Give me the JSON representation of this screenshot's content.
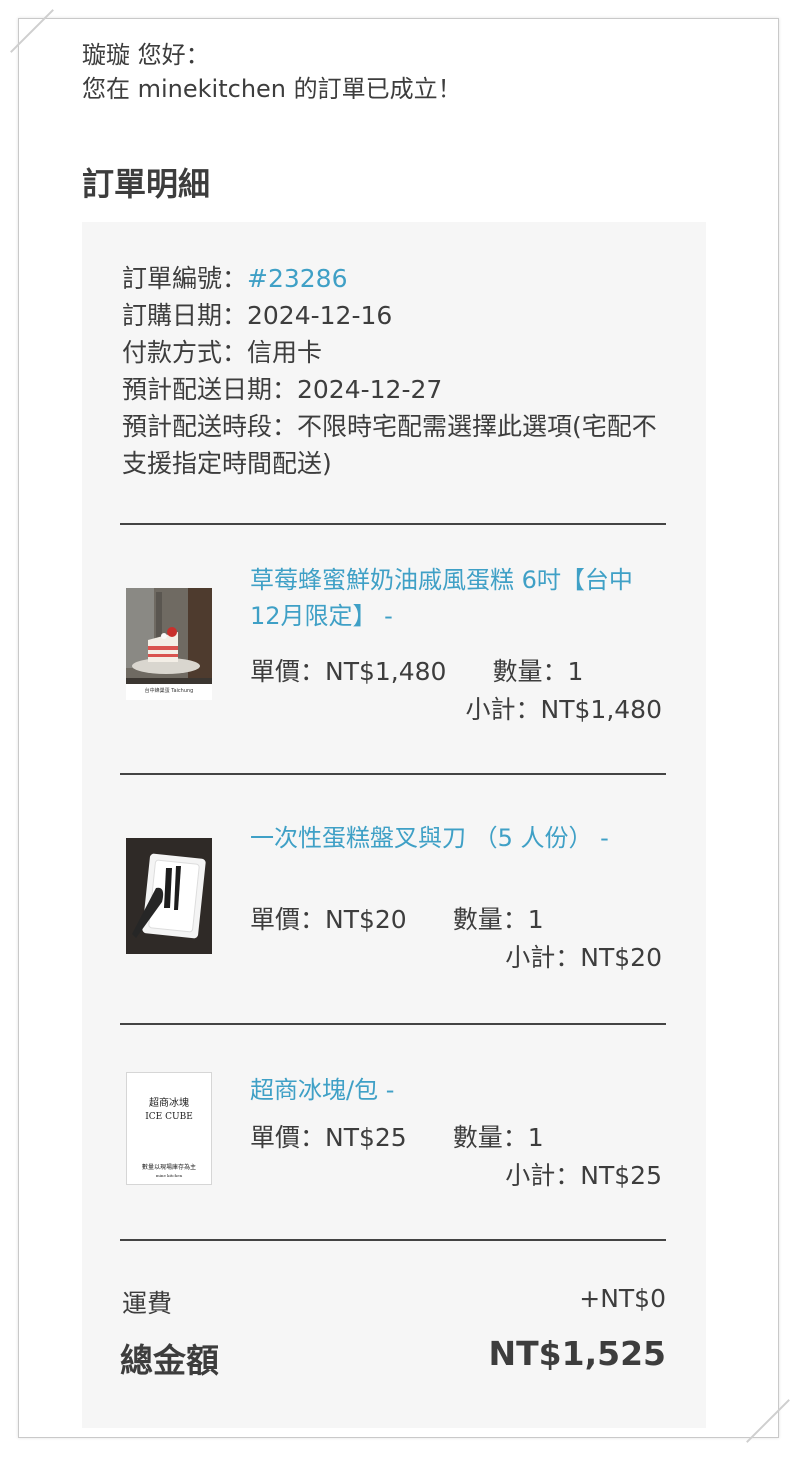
{
  "greeting": {
    "line1": "璇璇 您好：",
    "line2": "您在 minekitchen 的訂單已成立！"
  },
  "section_title": "訂單明細",
  "order": {
    "number_label": "訂單編號：",
    "number": "#23286",
    "date": "訂購日期：2024-12-16",
    "payment": "付款方式：信用卡",
    "delivery_date": "預計配送日期：2024-12-27",
    "delivery_slot": "預計配送時段：不限時宅配需選擇此選項(宅配不支援指定時間配送)"
  },
  "items": [
    {
      "title": "草莓蜂蜜鮮奶油戚風蛋糕 6吋【台中12月限定】 -",
      "price": "單價：NT$1,480",
      "qty": "數量：1",
      "subtotal": "小計：NT$1,480",
      "thumb_caption": "台中蜂巢蛋 Taichung"
    },
    {
      "title": "一次性蛋糕盤叉與刀 （5 人份） -",
      "price": "單價：NT$20",
      "qty": "數量：1",
      "subtotal": "小計：NT$20"
    },
    {
      "title": "超商冰塊/包 -",
      "price": "單價：NT$25",
      "qty": "數量：1",
      "subtotal": "小計：NT$25",
      "thumb_title_zh": "超商冰塊",
      "thumb_title_en": "ICE CUBE",
      "thumb_note": "數量以現場庫存為主",
      "thumb_brand": "mine kitchen"
    }
  ],
  "shipping": {
    "label": "運費",
    "value": "+NT$0"
  },
  "total": {
    "label": "總金額",
    "value": "NT$1,525"
  },
  "colors": {
    "link": "#3fa0c6",
    "panel": "#f6f6f6",
    "text": "#3d3d3d"
  }
}
